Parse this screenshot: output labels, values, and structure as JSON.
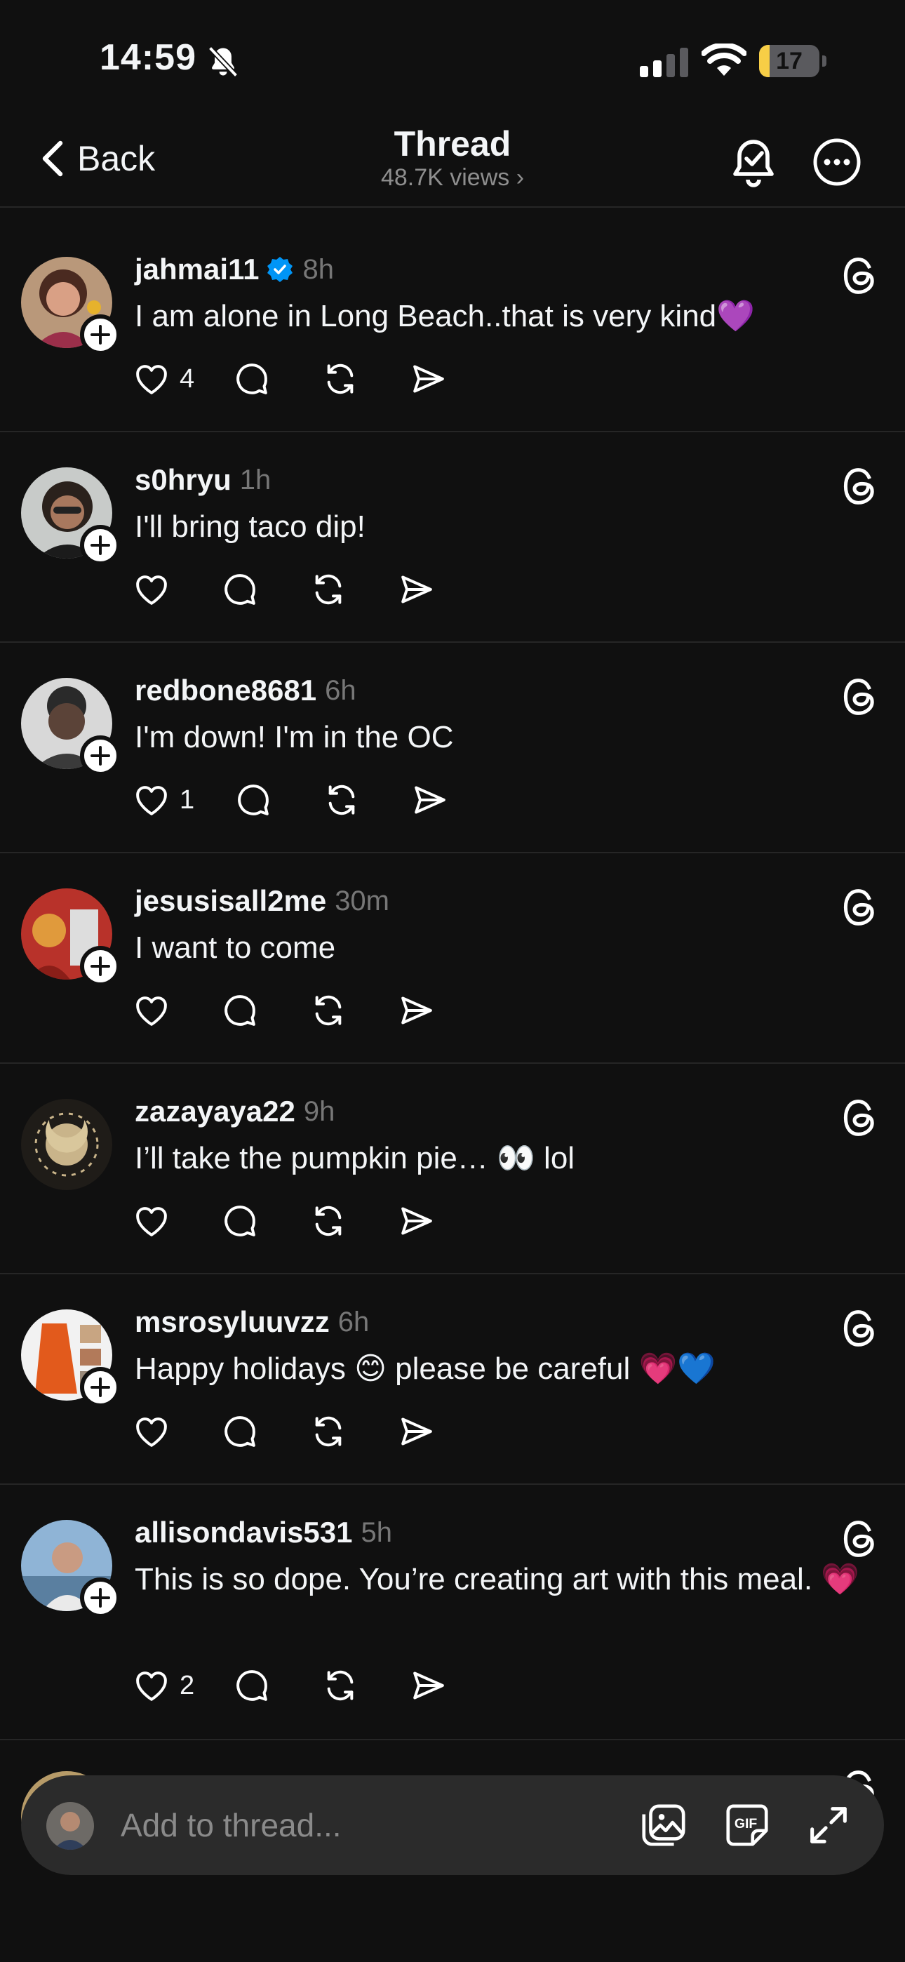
{
  "status_bar": {
    "time": "14:59",
    "battery": "17",
    "battery_level": 0.17
  },
  "nav": {
    "back_label": "Back",
    "title": "Thread",
    "views": "48.7K views"
  },
  "posts": [
    {
      "username": "jahmai11",
      "verified": true,
      "time": "8h",
      "text": "I am alone in Long Beach..that is very kind💜",
      "likes": "4"
    },
    {
      "username": "s0hryu",
      "verified": false,
      "time": "1h",
      "text": "I'll bring taco dip!",
      "likes": ""
    },
    {
      "username": "redbone8681",
      "verified": false,
      "time": "6h",
      "text": "I'm down! I'm in the OC",
      "likes": "1"
    },
    {
      "username": "jesusisall2me",
      "verified": false,
      "time": "30m",
      "text": "I want to come",
      "likes": ""
    },
    {
      "username": "zazayaya22",
      "verified": false,
      "time": "9h",
      "text": "I’ll take the pumpkin pie… 👀 lol",
      "likes": ""
    },
    {
      "username": "msrosyluuvzz",
      "verified": false,
      "time": "6h",
      "text": "Happy holidays 😊 please be careful 💗💙",
      "likes": ""
    },
    {
      "username": "allisondavis531",
      "verified": false,
      "time": "5h",
      "text": "This is so dope. You’re creating art with this meal. 💗",
      "likes": "2"
    }
  ],
  "composer": {
    "placeholder": "Add to thread..."
  },
  "colors": {
    "background": "#101010",
    "text": "#f3f5f7",
    "muted": "#8e8e8e",
    "verified": "#0095f6",
    "battery": "#f7ce46"
  }
}
